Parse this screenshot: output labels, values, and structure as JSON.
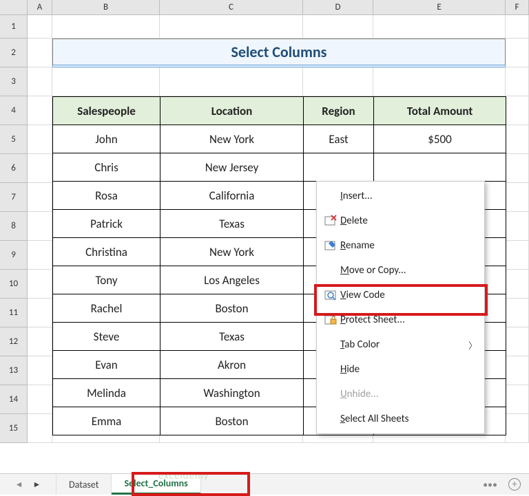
{
  "columns": [
    "A",
    "B",
    "C",
    "D",
    "E",
    "F"
  ],
  "rows": [
    "1",
    "2",
    "3",
    "4",
    "5",
    "6",
    "7",
    "8",
    "9",
    "10",
    "11",
    "12",
    "13",
    "14",
    "15"
  ],
  "title": "Select Columns",
  "table": {
    "headers": [
      "Salespeople",
      "Location",
      "Region",
      "Total Amount"
    ],
    "rows": [
      [
        "John",
        "New York",
        "East",
        "$500"
      ],
      [
        "Chris",
        "New Jersey",
        "",
        ""
      ],
      [
        "Rosa",
        "California",
        "",
        ""
      ],
      [
        "Patrick",
        "Texas",
        "",
        ""
      ],
      [
        "Christina",
        "New York",
        "",
        ""
      ],
      [
        "Tony",
        "Los Angeles",
        "",
        ""
      ],
      [
        "Rachel",
        "Boston",
        "",
        ""
      ],
      [
        "Steve",
        "Texas",
        "",
        ""
      ],
      [
        "Evan",
        "Akron",
        "",
        ""
      ],
      [
        "Melinda",
        "Washington",
        "",
        ""
      ],
      [
        "Emma",
        "Boston",
        "",
        ""
      ]
    ]
  },
  "ctx": {
    "insert": "Insert...",
    "delete": "Delete",
    "rename": "Rename",
    "move": "Move or Copy...",
    "view": "View Code",
    "protect": "Protect Sheet...",
    "tabcolor": "Tab Color",
    "hide": "Hide",
    "unhide": "Unhide...",
    "selectall": "Select All Sheets"
  },
  "tabs": {
    "dataset": "Dataset",
    "select": "Select_Columns"
  },
  "watermark": "exceldemy"
}
